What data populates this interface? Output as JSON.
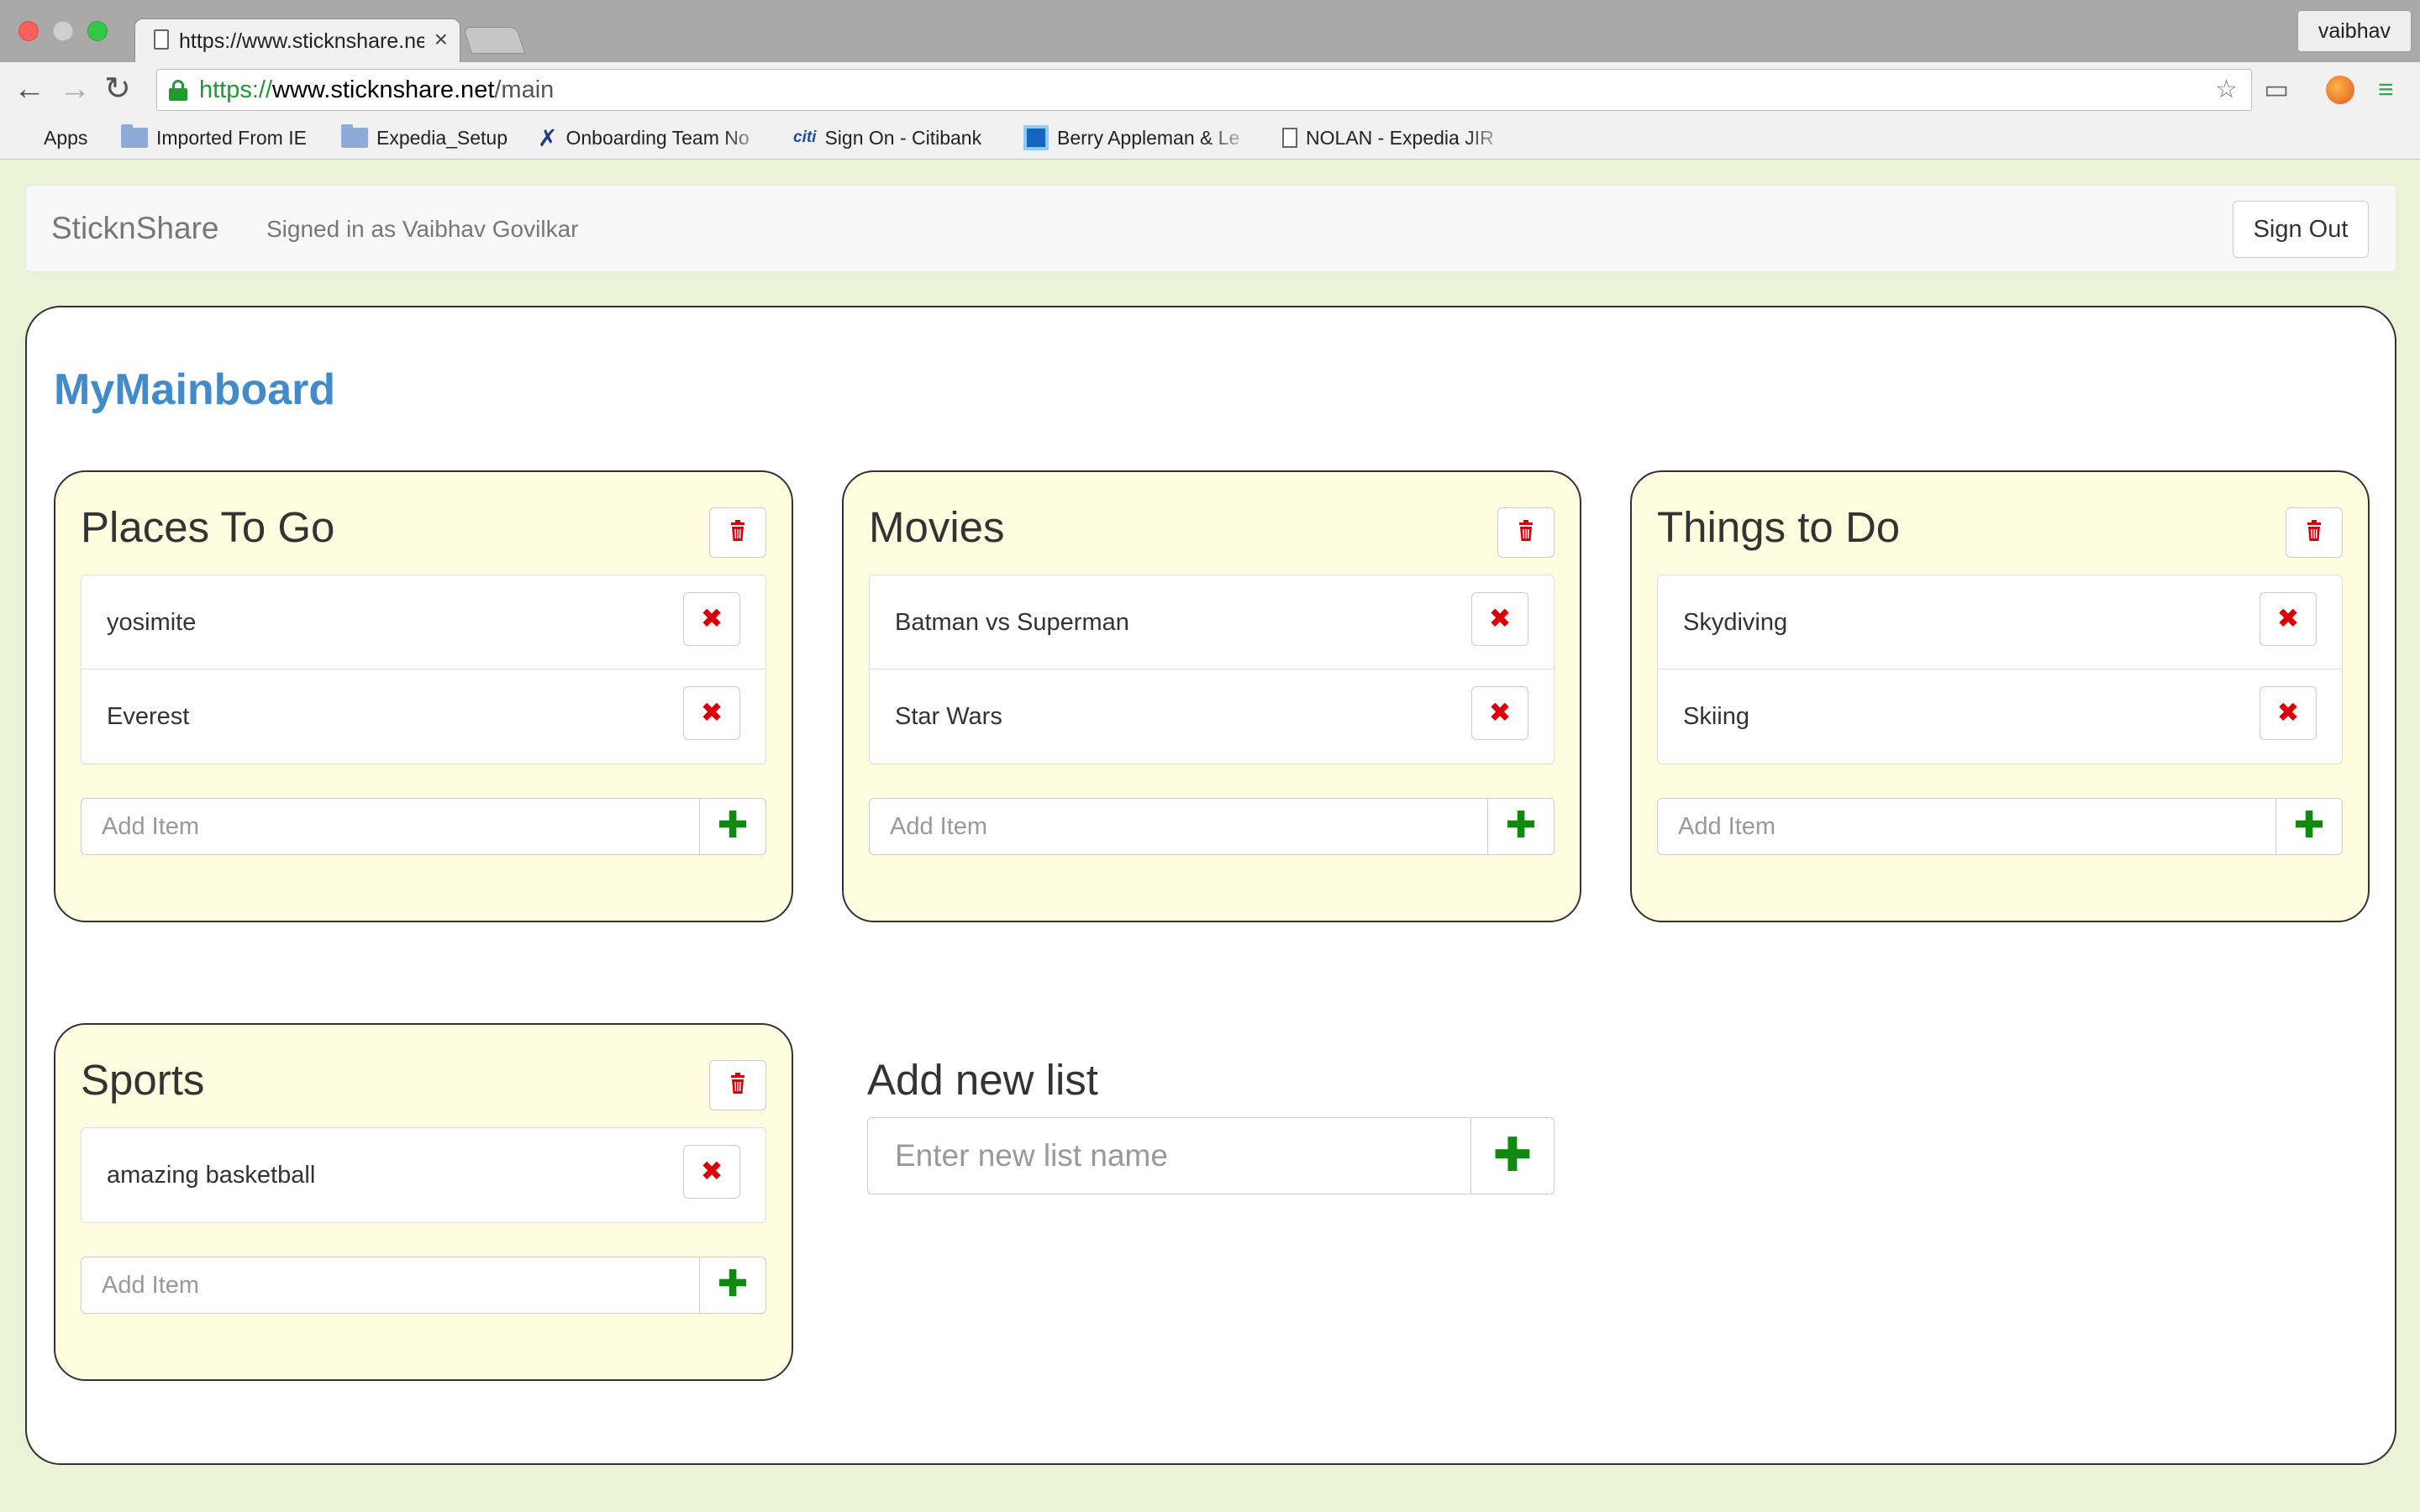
{
  "browser": {
    "tab_title": "https://www.sticknshare.ne",
    "tab_close": "×",
    "profile_name": "vaibhav",
    "url_scheme": "https://",
    "url_host": "www.sticknshare.net",
    "url_path": "/main",
    "icons": {
      "back": "←",
      "forward": "→",
      "reload": "↻",
      "bookmark_star": "☆",
      "cast": "▭",
      "menu": "≡"
    },
    "bookmarks": [
      {
        "label": "Apps",
        "icon": "apps-grid-icon"
      },
      {
        "label": "Imported From IE",
        "icon": "folder-icon"
      },
      {
        "label": "Expedia_Setup",
        "icon": "folder-icon"
      },
      {
        "label": "Onboarding Team No",
        "icon": "tools-icon"
      },
      {
        "label": "Sign On - Citibank",
        "icon": "citi-icon"
      },
      {
        "label": "Berry Appleman & Le",
        "icon": "bal-icon"
      },
      {
        "label": "NOLAN - Expedia JIR",
        "icon": "document-icon"
      }
    ]
  },
  "navbar": {
    "brand": "SticknShare",
    "signed_in_text": "Signed in as Vaibhav Govilkar",
    "sign_out_label": "Sign Out"
  },
  "board": {
    "title": "MyMainboard",
    "add_item_placeholder": "Add Item",
    "remove_symbol": "✖",
    "add_symbol": "✚",
    "lists": [
      {
        "title": "Places To Go",
        "items": [
          "yosimite",
          "Everest"
        ]
      },
      {
        "title": "Movies",
        "items": [
          "Batman vs Superman",
          "Star Wars"
        ]
      },
      {
        "title": "Things to Do",
        "items": [
          "Skydiving",
          "Skiing"
        ]
      },
      {
        "title": "Sports",
        "items": [
          "amazing basketball"
        ]
      }
    ],
    "new_list": {
      "title": "Add new list",
      "placeholder": "Enter new list name"
    }
  },
  "colors": {
    "page_background": "#eaf3d6",
    "card_background": "#fffce0",
    "board_title": "#428bca",
    "remove_red": "#d9000a",
    "add_green": "#11880f"
  }
}
